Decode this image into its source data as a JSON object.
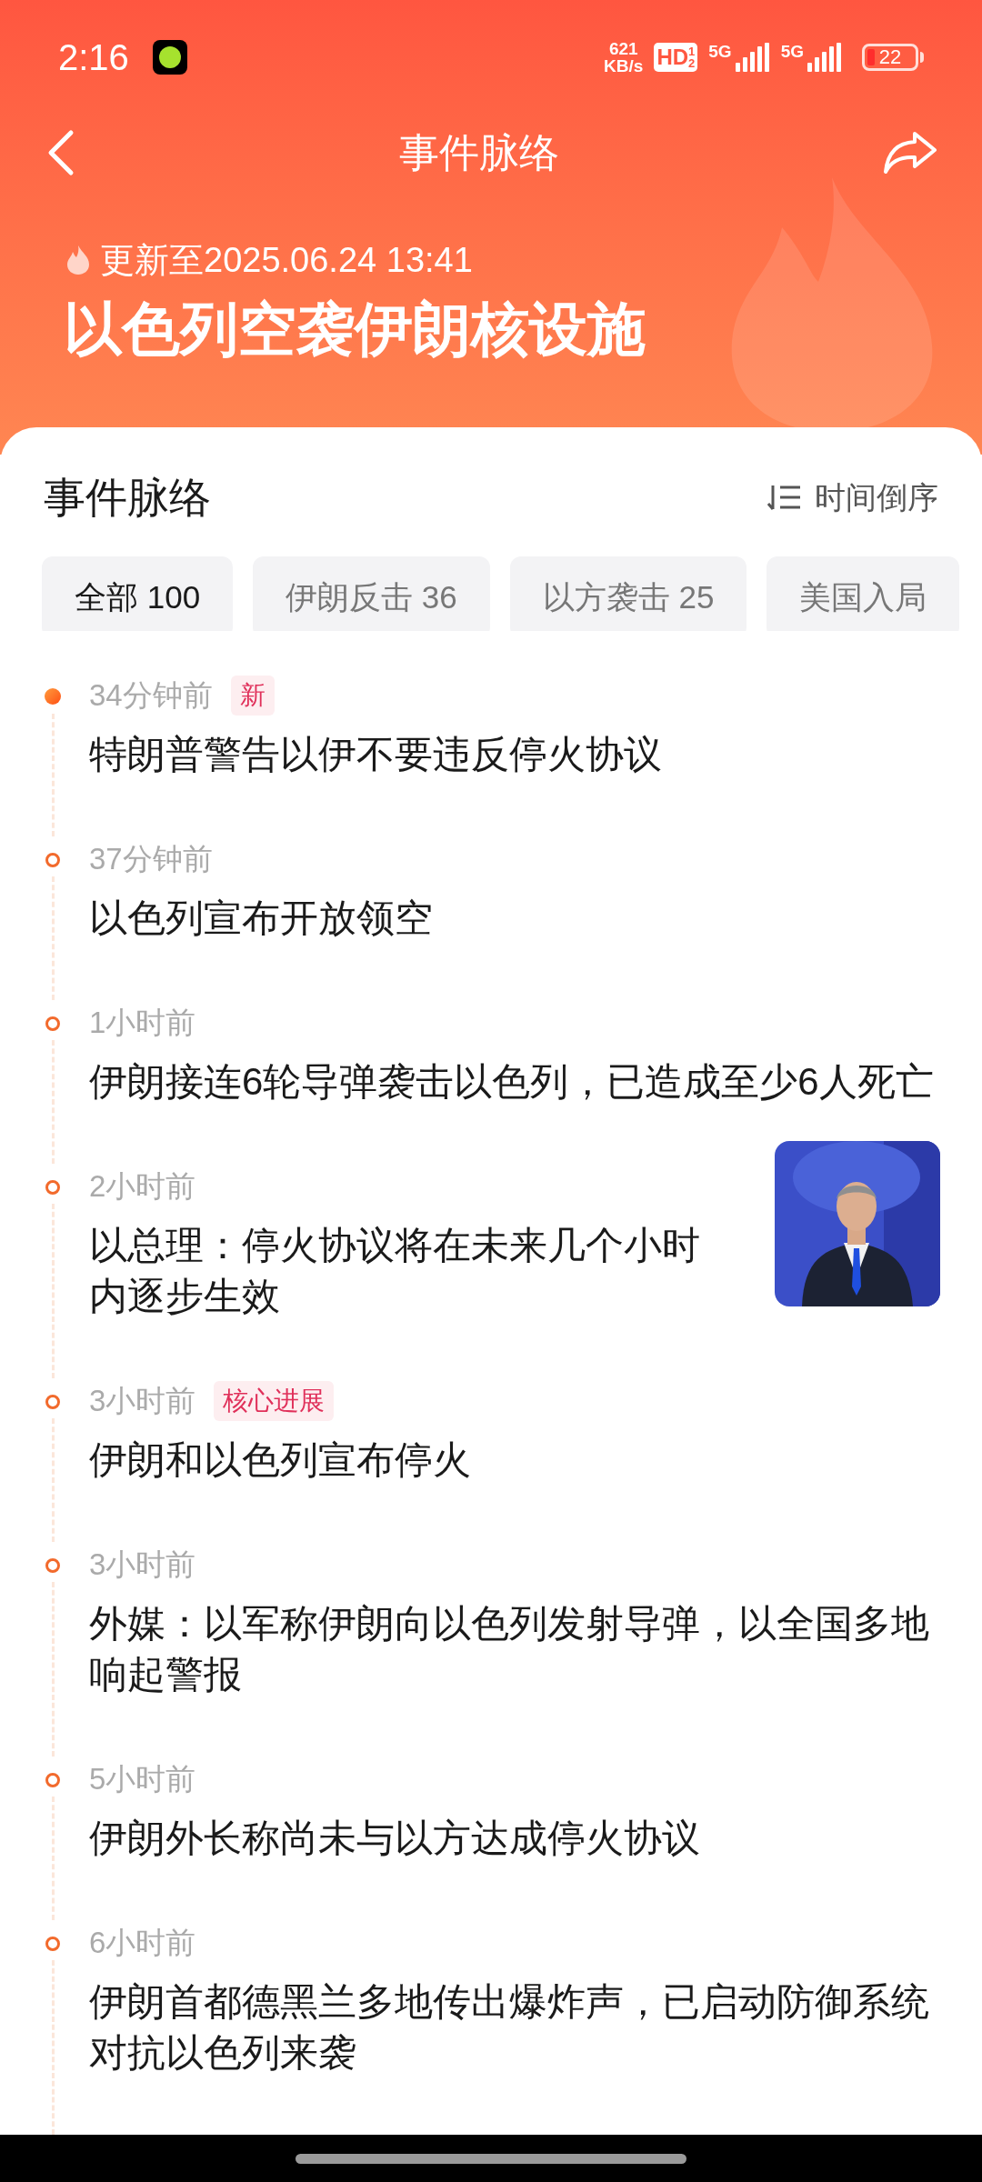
{
  "status_bar": {
    "time": "2:16",
    "net_speed": "621",
    "net_unit": "KB/s",
    "hd": "HD",
    "hd_sup": "1",
    "hd_sub": "2",
    "signals": [
      "5G",
      "5G"
    ],
    "battery": "22"
  },
  "header": {
    "title": "事件脉络",
    "updated": "更新至2025.06.24 13:41",
    "topic": "以色列空袭伊朗核设施"
  },
  "section": {
    "title": "事件脉络",
    "sort": "时间倒序"
  },
  "filters": [
    {
      "label": "全部 100",
      "selected": true
    },
    {
      "label": "伊朗反击 36",
      "selected": false
    },
    {
      "label": "以方袭击 25",
      "selected": false
    },
    {
      "label": "美国入局",
      "selected": false
    }
  ],
  "events": [
    {
      "time": "34分钟前",
      "tag": "新",
      "latest": true,
      "title": "特朗普警告以伊不要违反停火协议"
    },
    {
      "time": "37分钟前",
      "latest": false,
      "title": "以色列宣布开放领空"
    },
    {
      "time": "1小时前",
      "latest": false,
      "title": "伊朗接连6轮导弹袭击以色列，已造成至少6人死亡"
    },
    {
      "time": "2小时前",
      "latest": false,
      "title": "以总理：停火协议将在未来几个小时内逐步生效"
    },
    {
      "time": "3小时前",
      "tag": "核心进展",
      "latest": false,
      "title": "伊朗和以色列宣布停火"
    },
    {
      "time": "3小时前",
      "latest": false,
      "title": "外媒：以军称伊朗向以色列发射导弹，以全国多地响起警报"
    },
    {
      "time": "5小时前",
      "latest": false,
      "title": "伊朗外长称尚未与以方达成停火协议"
    },
    {
      "time": "6小时前",
      "latest": false,
      "title": "伊朗首都德黑兰多地传出爆炸声，已启动防御系统对抗以色列来袭"
    }
  ]
}
